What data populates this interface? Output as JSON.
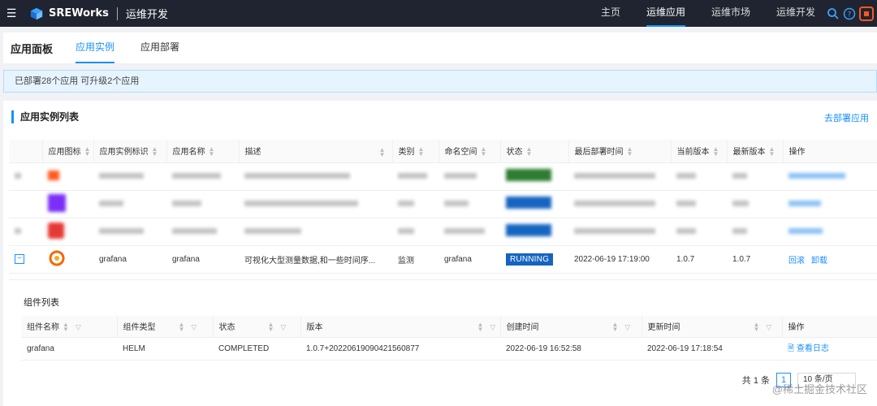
{
  "header": {
    "brand": "SREWorks",
    "subbrand": "运维开发",
    "nav": [
      {
        "label": "主页",
        "active": false
      },
      {
        "label": "运维应用",
        "active": true
      },
      {
        "label": "运维市场",
        "active": false
      },
      {
        "label": "运维开发",
        "active": false
      }
    ],
    "icons": [
      "search-icon",
      "help-icon",
      "app-icon"
    ],
    "accent": "#1890ff"
  },
  "tabs": {
    "title": "应用面板",
    "items": [
      "应用实例",
      "应用部署"
    ],
    "active": "应用实例"
  },
  "info": {
    "text": "已部署28个应用 可升级2个应用"
  },
  "card": {
    "title": "应用实例列表",
    "deploy_link": "去部署应用"
  },
  "table": {
    "columns": [
      "应用图标",
      "应用实例标识",
      "应用名称",
      "描述",
      "类别",
      "命名空间",
      "状态",
      "最后部署时间",
      "当前版本",
      "最新版本",
      "操作"
    ],
    "row": {
      "expand": "−",
      "id": "grafana",
      "name": "grafana",
      "desc": "可视化大型测量数据,和一些时间序...",
      "category": "监测",
      "namespace": "grafana",
      "status": "RUNNING",
      "deploy_time": "2022-06-19 17:19:00",
      "current_version": "1.0.7",
      "latest_version": "1.0.7",
      "action_rollback": "回滚",
      "action_uninstall": "卸载"
    }
  },
  "components": {
    "title": "组件列表",
    "columns": [
      "组件名称",
      "组件类型",
      "状态",
      "版本",
      "创建时间",
      "更新时间",
      "操作"
    ],
    "row": {
      "name": "grafana",
      "type": "HELM",
      "status": "COMPLETED",
      "version": "1.0.7+20220619090421560877",
      "created": "2022-06-19 16:52:58",
      "updated": "2022-06-19 17:18:54",
      "action": "查看日志"
    }
  },
  "pager": {
    "total": "共 1 条",
    "page": "1",
    "size": "10 条/页"
  },
  "watermark": "@稀土掘金技术社区"
}
